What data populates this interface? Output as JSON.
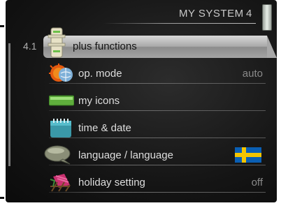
{
  "header": {
    "title": "MY SYSTEM",
    "number": "4"
  },
  "crumb": "4.1",
  "menu": [
    {
      "label": "plus functions",
      "value": "",
      "icon": "plus-functions-icon",
      "selected": true
    },
    {
      "label": "op. mode",
      "value": "auto",
      "icon": "sun-globe-icon",
      "selected": false
    },
    {
      "label": "my icons",
      "value": "",
      "icon": "battery-icon",
      "selected": false
    },
    {
      "label": "time & date",
      "value": "",
      "icon": "calendar-icon",
      "selected": false
    },
    {
      "label": "language / language",
      "value": "",
      "icon": "speech-bubble-icon",
      "selected": false,
      "flag": "swedish-flag-icon"
    },
    {
      "label": "holiday setting",
      "value": "off",
      "icon": "beach-chair-icon",
      "selected": false
    }
  ],
  "colors": {
    "screen_bg": "#151515",
    "selected_bg": "#a9a9a9",
    "text": "#dedede",
    "value_text": "#8a8a8a",
    "flag_blue": "#0a5fb4",
    "flag_yellow": "#f3c400",
    "icon_green": "#6cc04a"
  }
}
